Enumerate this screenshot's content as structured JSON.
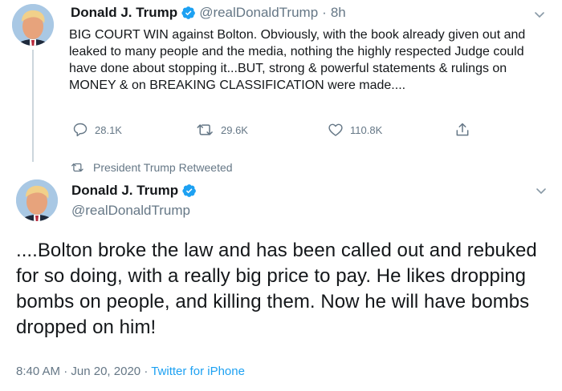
{
  "colors": {
    "accent": "#1da1f2",
    "muted": "#657786",
    "text": "#14171a"
  },
  "tweet1": {
    "name": "Donald J. Trump",
    "handle": "@realDonaldTrump",
    "separator": "·",
    "time": "8h",
    "text": "BIG COURT WIN against Bolton. Obviously, with the book already given out and leaked to many people and the media, nothing the highly respected Judge could have done about stopping it...BUT, strong & powerful statements & rulings on MONEY & on BREAKING CLASSIFICATION were made....",
    "replies": "28.1K",
    "retweets": "29.6K",
    "likes": "110.8K",
    "icons": [
      "reply-icon",
      "retweet-icon",
      "like-icon",
      "share-icon",
      "chevron-down-icon",
      "verified-icon"
    ]
  },
  "retweet_banner": {
    "text": "President Trump Retweeted",
    "icon": "retweet-icon"
  },
  "tweet2": {
    "name": "Donald J. Trump",
    "handle": "@realDonaldTrump",
    "text": "....Bolton broke the law and has been called out and rebuked for so doing, with a really big price to pay. He likes dropping bombs on people, and killing them. Now he will have bombs dropped on him!",
    "time": "8:40 AM",
    "separator": "·",
    "date": "Jun 20, 2020",
    "source": "Twitter for iPhone"
  }
}
